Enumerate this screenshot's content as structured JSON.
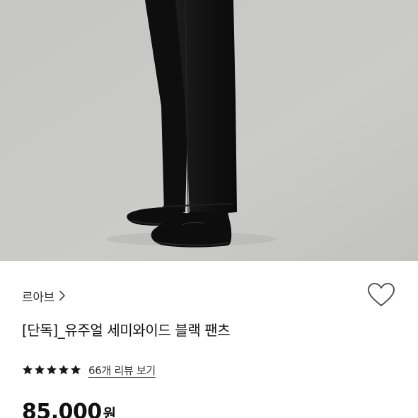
{
  "product": {
    "brand": "르아브",
    "title": "[단독]_유주얼 세미와이드 블랙 팬츠",
    "rating_stars": 5,
    "review_text": "66개 리뷰 보기",
    "price_value": "85,000",
    "price_unit": "원"
  },
  "icons": {
    "brand_chevron": "chevron-right-icon",
    "wishlist": "heart-outline-icon",
    "rating": "star-icon"
  },
  "colors": {
    "photo_background": "#c9c9c7",
    "pants": "#141414",
    "shoes": "#0d0d0d",
    "star": "#1a1a1a",
    "heart_outline": "#444444"
  }
}
